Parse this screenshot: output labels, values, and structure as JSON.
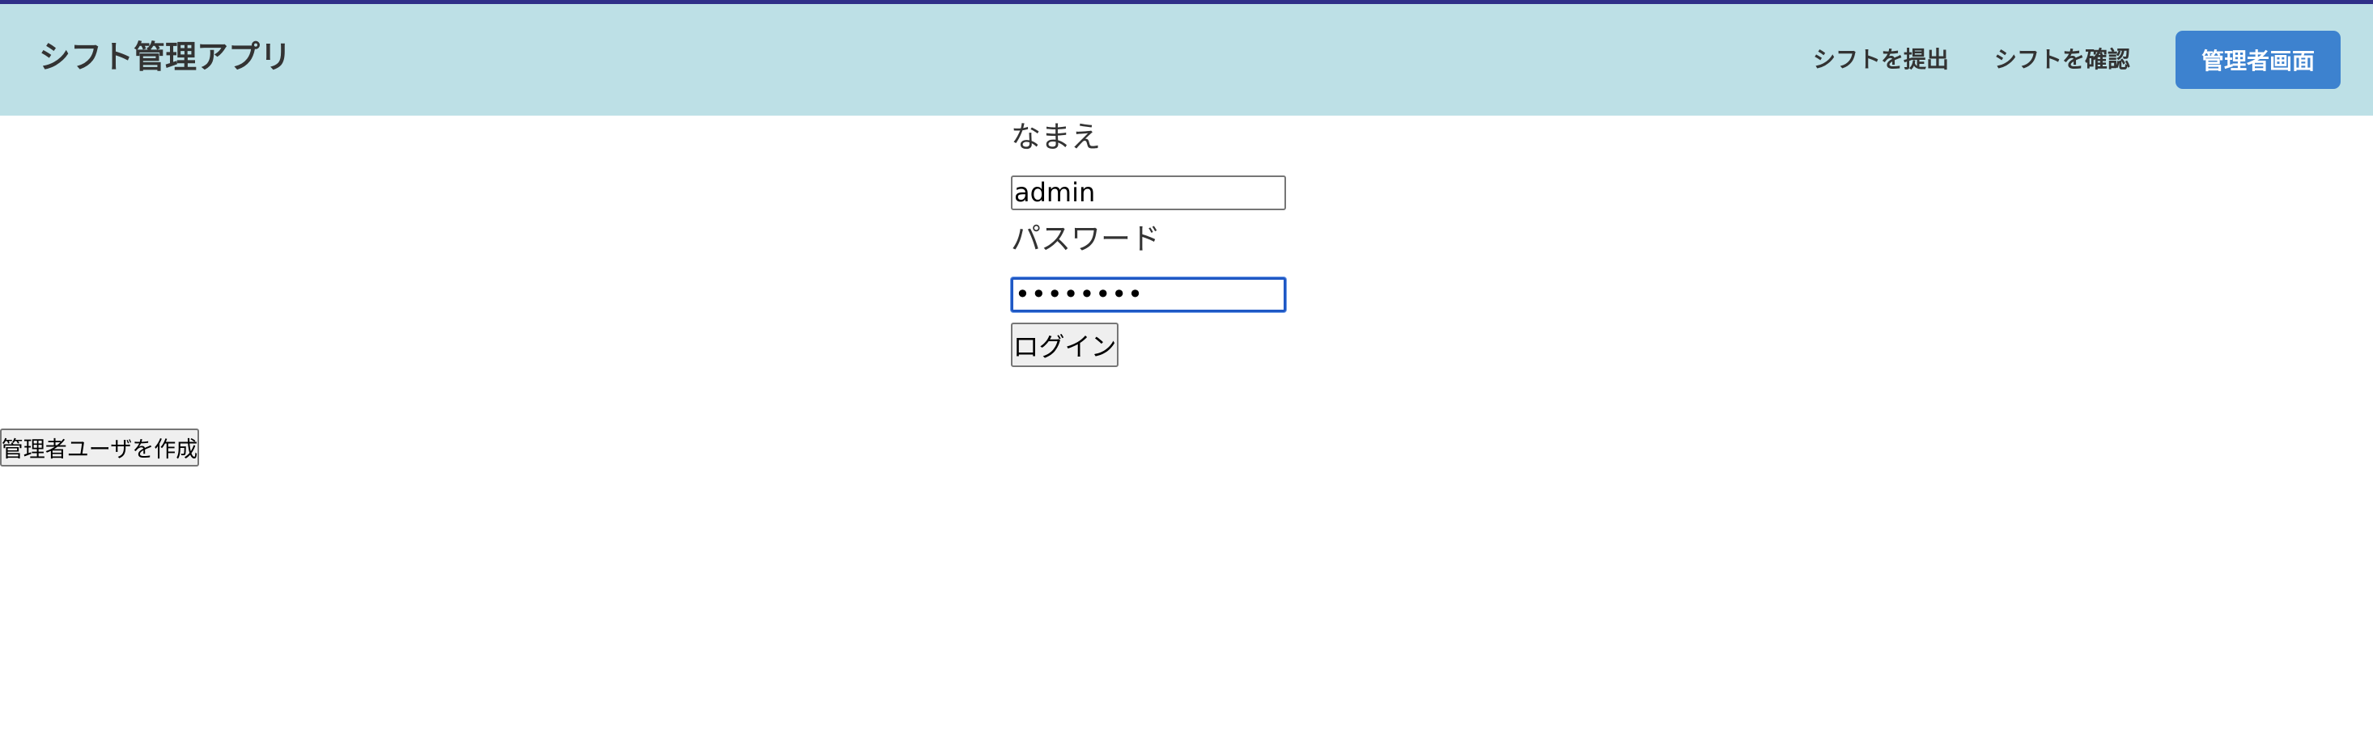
{
  "colors": {
    "navbar_bg": "#bde0e6",
    "top_accent": "#2f2f88",
    "primary_button": "#3d82cf",
    "focus_border": "#1f58c4"
  },
  "header": {
    "brand": "シフト管理アプリ",
    "nav": {
      "submit_shift": "シフトを提出",
      "check_shift": "シフトを確認",
      "admin_screen": "管理者画面"
    }
  },
  "login_form": {
    "name_label": "なまえ",
    "name_value": "admin",
    "password_label": "パスワード",
    "password_value": "••••••••",
    "login_button": "ログイン"
  },
  "create_admin_button": "管理者ユーザを作成"
}
